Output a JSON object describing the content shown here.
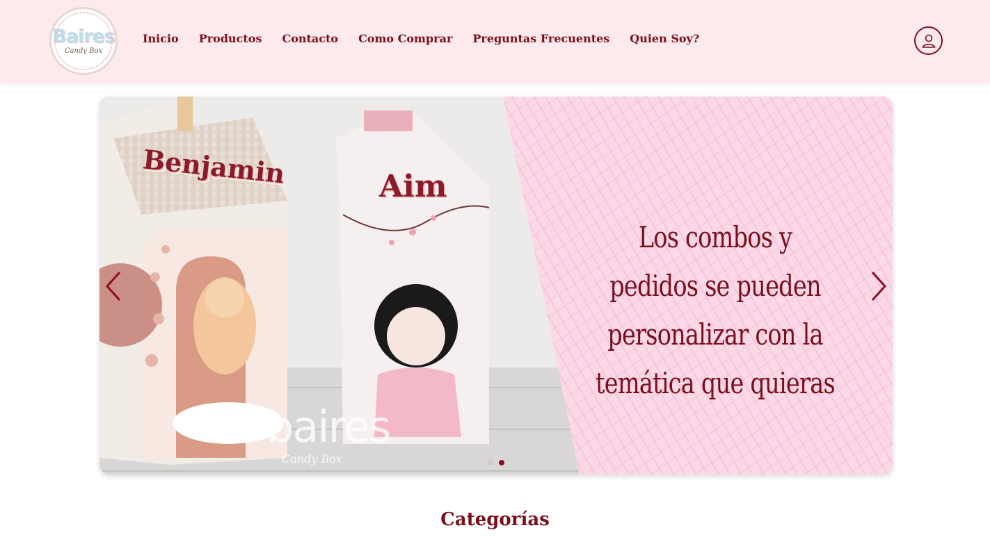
{
  "header": {
    "logo": {
      "main": "Baires",
      "sub": "Candy Box"
    },
    "nav": [
      "Inicio",
      "Productos",
      "Contacto",
      "Como Comprar",
      "Preguntas Frecuentes",
      "Quien Soy?"
    ],
    "user_icon": "user-icon"
  },
  "carousel": {
    "slide_text": "Los combos y pedidos se pueden personalizar con la temática que quieras",
    "box_names": [
      "Benjamin",
      "Aim"
    ],
    "watermark": {
      "main": "baires",
      "sub": "Candy Box"
    },
    "active_slide": 2,
    "slide_count": 2,
    "prev_icon": "chevron-left-icon",
    "next_icon": "chevron-right-icon"
  },
  "sections": {
    "categories_title": "Categorías"
  },
  "colors": {
    "header_bg": "#fdeaec",
    "brand": "#7a0f1d",
    "slide_pink": "#fbd9e7"
  }
}
